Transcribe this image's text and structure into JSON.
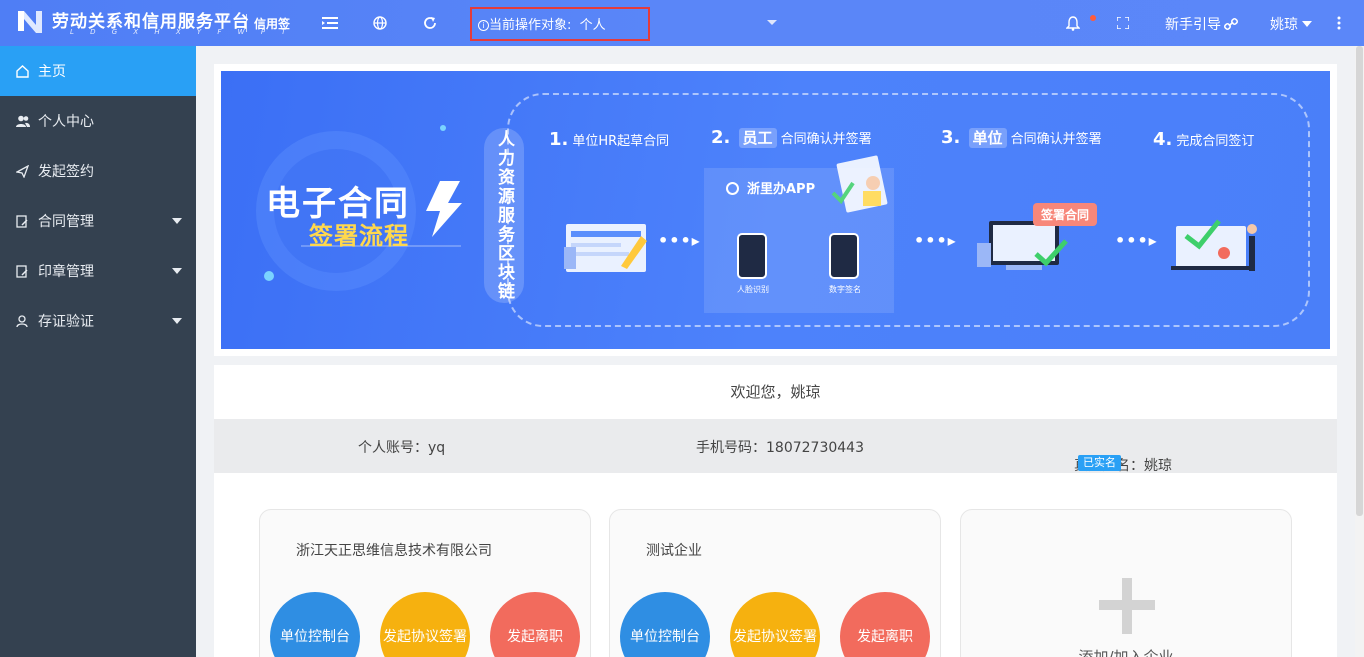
{
  "header": {
    "brand": "劳动关系和信用服务平台",
    "brand_sub": "L D G X H X Y F W P T",
    "tag": "信用签",
    "operator_label": "当前操作对象:",
    "operator_value": "个人",
    "guide": "新手引导",
    "user": "姚琼",
    "icons": [
      "menu-fold-icon",
      "globe-icon",
      "refresh-icon",
      "bell-icon",
      "fullscreen-icon",
      "link-icon",
      "more-vertical-icon"
    ],
    "accent": "#5b87f9"
  },
  "sidebar": {
    "items": [
      {
        "label": "主页",
        "icon": "home-icon",
        "active": true
      },
      {
        "label": "个人中心",
        "icon": "users-icon"
      },
      {
        "label": "发起签约",
        "icon": "send-icon"
      },
      {
        "label": "合同管理",
        "icon": "contract-icon"
      },
      {
        "label": "印章管理",
        "icon": "seal-icon"
      },
      {
        "label": "存证验证",
        "icon": "person-icon"
      }
    ]
  },
  "banner": {
    "title": "电子合同",
    "subtitle": "签署流程",
    "vertical": "人力资源服务区块链",
    "step1": {
      "num": "1.",
      "text": "单位HR起草合同"
    },
    "step2": {
      "num": "2.",
      "highlight": "员工",
      "text": "合同确认并签署"
    },
    "step3": {
      "num": "3.",
      "highlight": "单位",
      "text": "合同确认并签署"
    },
    "step4": {
      "num": "4.",
      "text": "完成合同签订"
    },
    "app": "浙里办APP",
    "face": "人脸识别",
    "digital": "数字签名",
    "sign_bubble": "签署合同"
  },
  "welcome": "欢迎您，姚琼",
  "info": {
    "account": "个人账号：yq",
    "phone": "手机号码：18072730443",
    "realname": "真实姓名：姚琼",
    "verified": "已实名"
  },
  "companies": [
    {
      "name": "浙江天正思维信息技术有限公司",
      "actions": [
        "单位控制台",
        "发起协议签署",
        "发起离职"
      ]
    },
    {
      "name": "测试企业",
      "actions": [
        "单位控制台",
        "发起协议签署",
        "发起离职"
      ]
    }
  ],
  "add_company": "添加/加入企业"
}
